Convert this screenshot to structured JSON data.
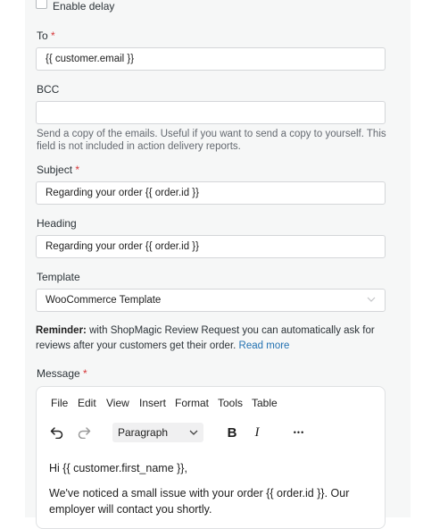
{
  "delay": {
    "label": "Enable delay",
    "checked": false
  },
  "to": {
    "label": "To",
    "required_mark": "*",
    "value": "{{ customer.email }}"
  },
  "bcc": {
    "label": "BCC",
    "value": "",
    "help_line1": "Send a copy of the emails. Useful if you want to send a copy to yourself. This",
    "help_line2": "field is not included in action delivery reports."
  },
  "subject": {
    "label": "Subject",
    "required_mark": "*",
    "value": "Regarding your order {{ order.id }}"
  },
  "heading": {
    "label": "Heading",
    "value": "Regarding your order {{ order.id }}"
  },
  "template": {
    "label": "Template",
    "value": "WooCommerce Template"
  },
  "reminder": {
    "strong": "Reminder:",
    "text1": " with ShopMagic Review Request you can automatically ask for",
    "text2": "reviews after your customers get their order. ",
    "link": "Read more"
  },
  "message": {
    "label": "Message",
    "required_mark": "*",
    "menu": [
      "File",
      "Edit",
      "View",
      "Insert",
      "Format",
      "Tools",
      "Table"
    ],
    "format_value": "Paragraph",
    "bold_label": "B",
    "italic_label": "I",
    "more_label": "•••",
    "content_p1": "Hi {{ customer.first_name }},",
    "content_p2": "We've noticed a small issue with your order {{ order.id }}. Our employer will contact you shortly."
  },
  "icons": {
    "undo": "undo-icon",
    "redo": "redo-icon",
    "chevron": "chevron-down-icon"
  },
  "colors": {
    "required": "#d63638",
    "link": "#2271b1",
    "border": "#d4d6d9"
  }
}
